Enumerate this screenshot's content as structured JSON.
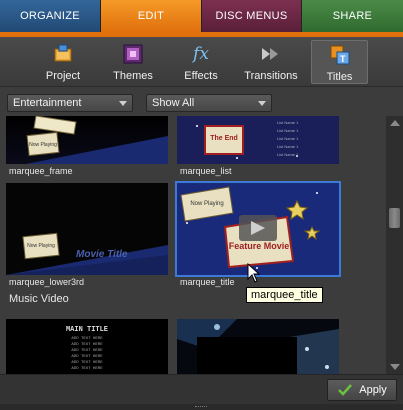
{
  "tabs": [
    {
      "label": "ORGANIZE"
    },
    {
      "label": "EDIT"
    },
    {
      "label": "DISC MENUS"
    },
    {
      "label": "SHARE"
    }
  ],
  "toolbar": {
    "items": [
      {
        "label": "Project",
        "icon": "project-icon"
      },
      {
        "label": "Themes",
        "icon": "themes-icon"
      },
      {
        "label": "Effects",
        "icon": "effects-icon",
        "glyph": "fx"
      },
      {
        "label": "Transitions",
        "icon": "transitions-icon"
      },
      {
        "label": "Titles",
        "icon": "titles-icon",
        "selected": true
      }
    ]
  },
  "filters": {
    "category": "Entertainment",
    "show": "Show All"
  },
  "sections": {
    "music_video": "Music Video"
  },
  "thumbs": {
    "marquee_frame": {
      "label": "marquee_frame",
      "sign": "Now Playing"
    },
    "marquee_list": {
      "label": "marquee_list",
      "sign": "The End",
      "list_text": "List Name 1"
    },
    "marquee_lower3rd": {
      "label": "marquee_lower3rd",
      "sign": "Now Playing",
      "title": "Movie Title"
    },
    "marquee_title": {
      "label": "marquee_title",
      "sign": "Now Playing",
      "board": "Feature Movie"
    },
    "music1": {
      "main": "MAIN TITLE",
      "line": "ADD TEXT HERE"
    }
  },
  "tooltip": "marquee_title",
  "apply_label": "Apply",
  "colors": {
    "organize": "#214a75",
    "edit": "#e0700c",
    "disc_menus": "#5a1f38",
    "share": "#2f6b2e",
    "selection": "#3b7ad6"
  }
}
